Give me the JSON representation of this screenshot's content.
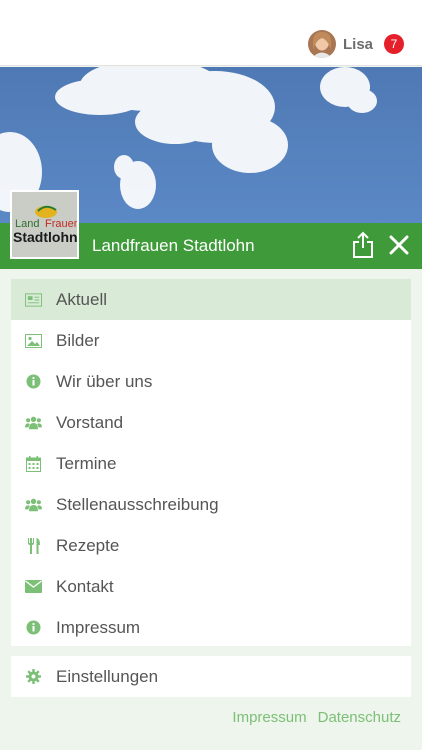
{
  "user": {
    "name": "Lisa",
    "notifications": "7"
  },
  "logo": {
    "line1_left": "Land",
    "line1_right": "Frauen",
    "line2": "Stadtlohn"
  },
  "header": {
    "title": "Landfrauen Stadtlohn"
  },
  "menu": {
    "items": [
      {
        "label": "Aktuell",
        "icon": "newspaper-icon",
        "active": true
      },
      {
        "label": "Bilder",
        "icon": "image-icon"
      },
      {
        "label": "Wir über uns",
        "icon": "info-icon"
      },
      {
        "label": "Vorstand",
        "icon": "users-icon"
      },
      {
        "label": "Termine",
        "icon": "calendar-icon"
      },
      {
        "label": "Stellenausschreibung",
        "icon": "users-icon"
      },
      {
        "label": "Rezepte",
        "icon": "cutlery-icon"
      },
      {
        "label": "Kontakt",
        "icon": "envelope-icon"
      },
      {
        "label": "Impressum",
        "icon": "info-icon"
      }
    ]
  },
  "settings": {
    "label": "Einstellungen",
    "icon": "gear-icon"
  },
  "footer": {
    "impressum": "Impressum",
    "datenschutz": "Datenschutz"
  },
  "colors": {
    "accent": "#3f9b3a",
    "active_row": "#d9ebd6",
    "icon": "#7cbf77",
    "badge": "#e5202a",
    "background": "#eef5ec"
  }
}
